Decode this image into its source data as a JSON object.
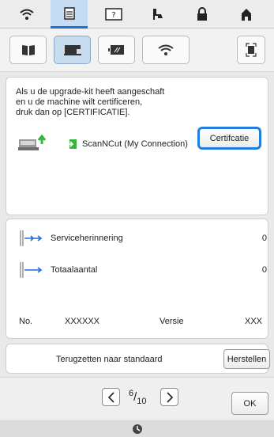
{
  "top_tabs": [
    {
      "icon": "wifi-icon"
    },
    {
      "icon": "document-icon",
      "active": true
    },
    {
      "icon": "help-icon"
    },
    {
      "icon": "presser-foot-icon"
    },
    {
      "icon": "lock-icon"
    },
    {
      "icon": "home-icon"
    }
  ],
  "sub_tabs": [
    {
      "icon": "book-icon"
    },
    {
      "icon": "sewing-machine-icon",
      "active": true
    },
    {
      "icon": "screen-icon"
    },
    {
      "icon": "wifi-icon"
    },
    {
      "icon": "fullscreen-icon"
    }
  ],
  "certification": {
    "message": "Als u de upgrade-kit heeft aangeschaft\nen u de machine wilt certificeren,\ndruk dan op [CERTIFICATIE].",
    "connection_label": "ScanNCut (My Connection)",
    "button_label": "Certifcatie"
  },
  "info": {
    "service_label": "Serviceherinnering",
    "service_value": "0",
    "total_label": "Totaalaantal",
    "total_value": "0",
    "no_label": "No.",
    "no_value": "XXXXXX",
    "version_label": "Versie",
    "version_value": "XXX"
  },
  "reset": {
    "label": "Terugzetten naar standaard",
    "button_label": "Herstellen"
  },
  "pagination": {
    "current": "6",
    "total": "10"
  },
  "ok_label": "OK",
  "colors": {
    "accent": "#1f7fe0",
    "active_tab": "#c6dcf2"
  }
}
